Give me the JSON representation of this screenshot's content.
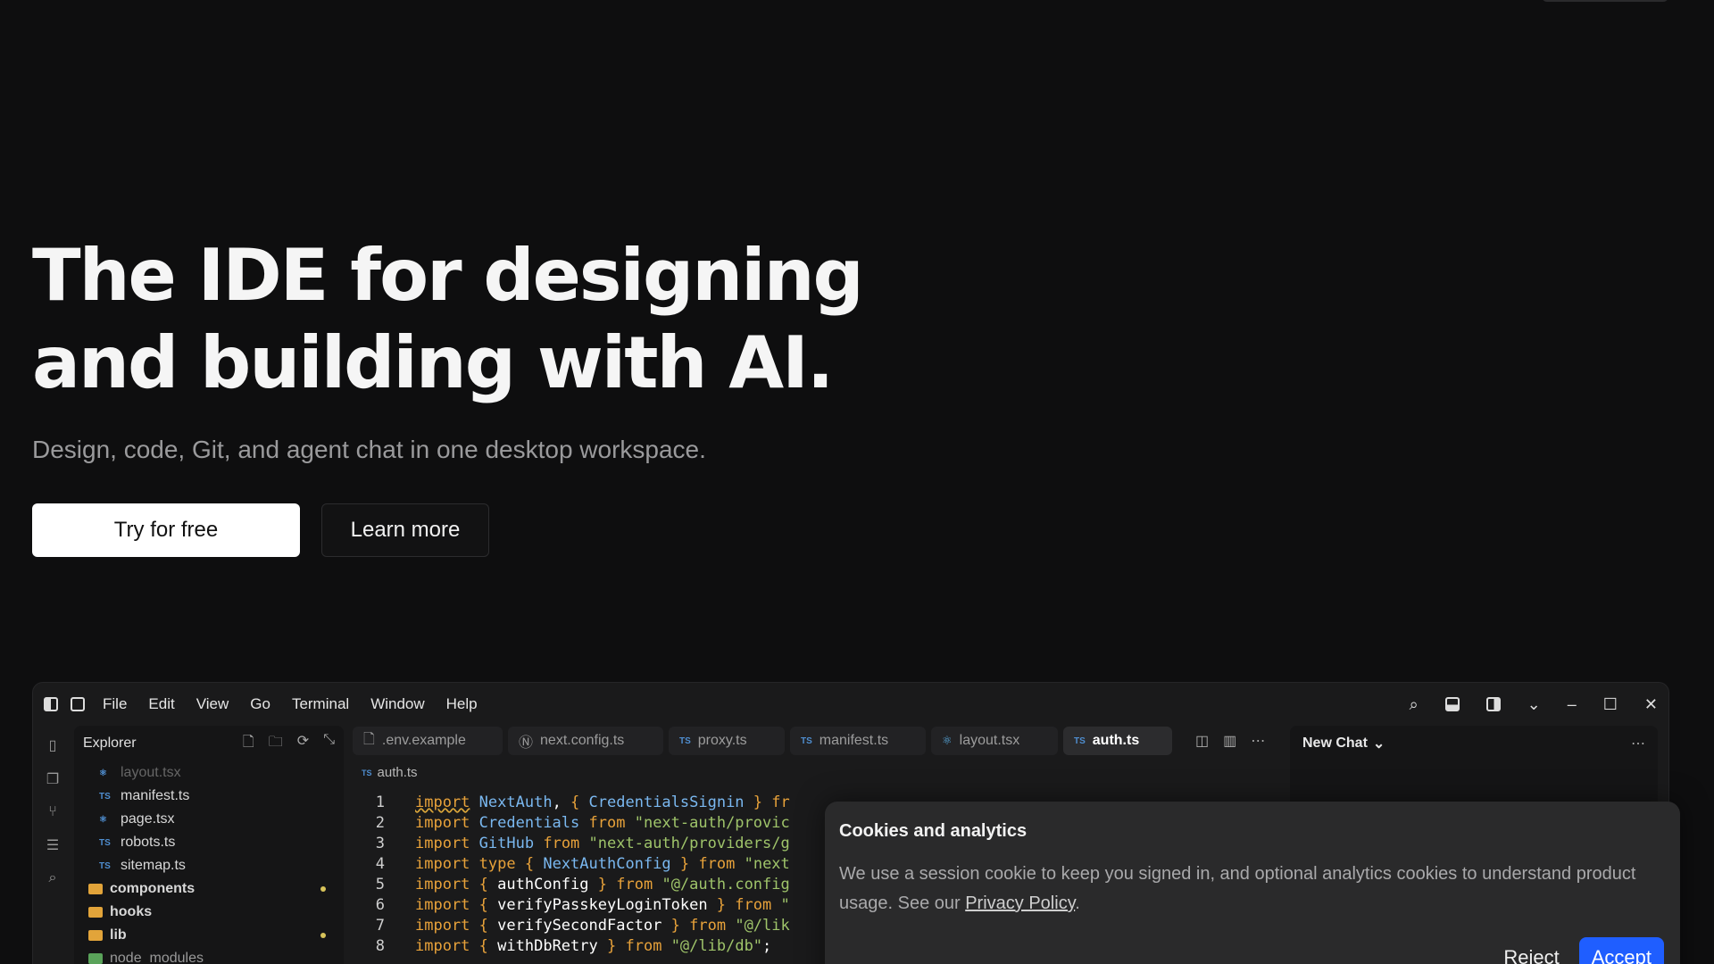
{
  "hero": {
    "title_line1": "The IDE for designing",
    "title_line2": "and building with AI.",
    "subtitle": "Design, code, Git, and agent chat in one desktop workspace.",
    "primary_cta": "Try for free",
    "secondary_cta": "Learn more"
  },
  "ide": {
    "menu": [
      "File",
      "Edit",
      "View",
      "Go",
      "Terminal",
      "Window",
      "Help"
    ],
    "explorer_title": "Explorer",
    "tree": [
      {
        "label": "layout.tsx"
      },
      {
        "label": "manifest.ts"
      },
      {
        "label": "page.tsx"
      },
      {
        "label": "robots.ts"
      },
      {
        "label": "sitemap.ts"
      },
      {
        "label": "components"
      },
      {
        "label": "hooks"
      },
      {
        "label": "lib"
      },
      {
        "label": "node_modules"
      }
    ],
    "tabs": [
      ".env.example",
      "next.config.ts",
      "proxy.ts",
      "manifest.ts",
      "layout.tsx",
      "auth.ts"
    ],
    "breadcrumb": "auth.ts",
    "code_lines": [
      {
        "n": "1"
      },
      {
        "n": "2"
      },
      {
        "n": "3"
      },
      {
        "n": "4"
      },
      {
        "n": "5"
      },
      {
        "n": "6"
      },
      {
        "n": "7"
      },
      {
        "n": "8"
      }
    ],
    "chat_title": "New Chat",
    "file_badge": "TS"
  },
  "cookie": {
    "title": "Cookies and analytics",
    "body": "We use a session cookie to keep you signed in, and optional analytics cookies to understand product usage. See our ",
    "link": "Privacy Policy",
    "period": ".",
    "reject": "Reject",
    "accept": "Accept"
  },
  "colors": {
    "accent": "#1f5eff",
    "background": "#0e0e0f"
  }
}
